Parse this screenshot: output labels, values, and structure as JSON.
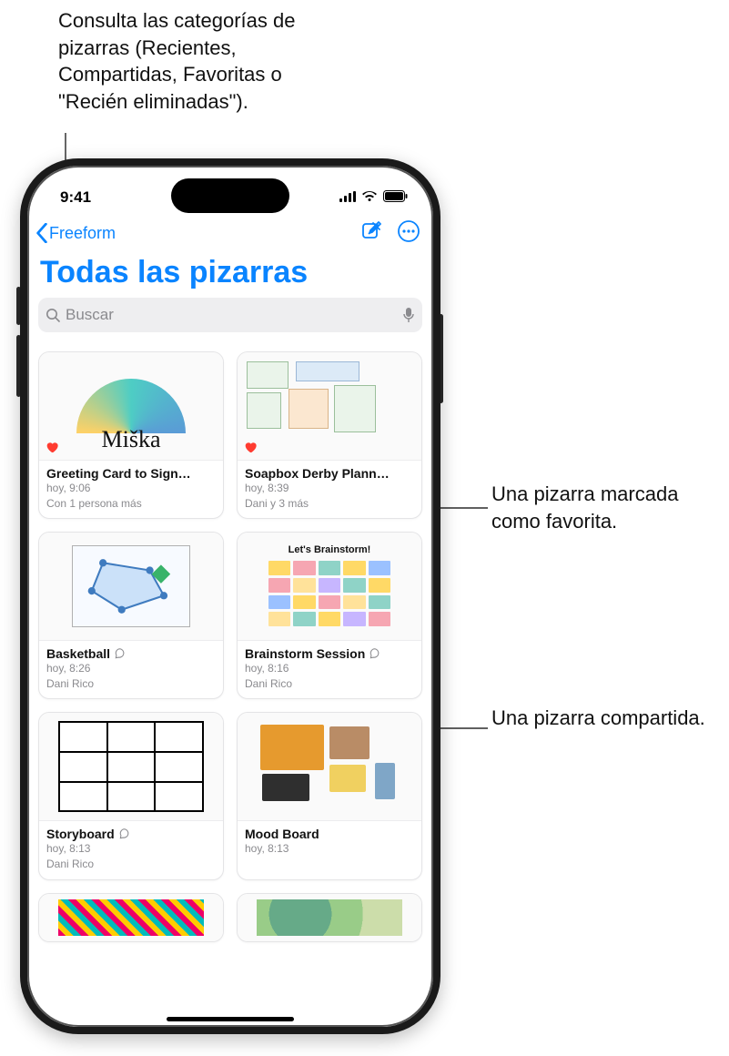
{
  "callouts": {
    "categories": "Consulta las categorías de pizarras (Recientes, Compartidas, Favoritas o \"Recién eliminadas\").",
    "favorite": "Una pizarra marcada como favorita.",
    "shared": "Una pizarra compartida."
  },
  "statusbar": {
    "time": "9:41"
  },
  "nav": {
    "back_label": "Freeform",
    "page_title": "Todas las pizarras"
  },
  "search": {
    "placeholder": "Buscar"
  },
  "stickies_title": "Let's Brainstorm!",
  "boards": [
    {
      "title": "Greeting Card to Sign…",
      "time": "hoy, 9:06",
      "people": "Con 1 persona más",
      "favorite": true,
      "shared": false
    },
    {
      "title": "Soapbox Derby Plann…",
      "time": "hoy, 8:39",
      "people": "Dani y 3 más",
      "favorite": true,
      "shared": false
    },
    {
      "title": "Basketball",
      "time": "hoy, 8:26",
      "people": "Dani Rico",
      "favorite": false,
      "shared": true
    },
    {
      "title": "Brainstorm Session",
      "time": "hoy, 8:16",
      "people": "Dani Rico",
      "favorite": false,
      "shared": true
    },
    {
      "title": "Storyboard",
      "time": "hoy, 8:13",
      "people": "Dani Rico",
      "favorite": false,
      "shared": true
    },
    {
      "title": "Mood Board",
      "time": "hoy, 8:13",
      "people": "",
      "favorite": false,
      "shared": false
    }
  ],
  "colors": {
    "accent": "#0a84ff",
    "heart": "#ff3b30",
    "search_bg": "#eeeef0"
  }
}
